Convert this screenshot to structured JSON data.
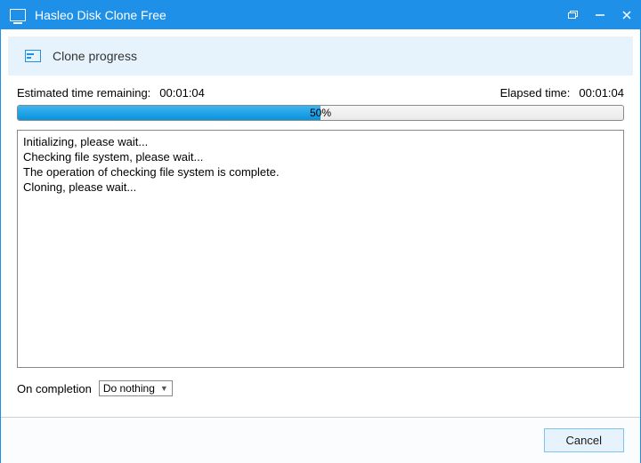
{
  "window": {
    "title": "Hasleo Disk Clone Free"
  },
  "header": {
    "subtitle": "Clone progress"
  },
  "times": {
    "remaining_label": "Estimated time remaining:",
    "remaining_value": "00:01:04",
    "elapsed_label": "Elapsed time:",
    "elapsed_value": "00:01:04"
  },
  "progress": {
    "percent": 50,
    "text": "50%"
  },
  "log": [
    "Initializing, please wait...",
    "Checking file system, please wait...",
    "The operation of checking file system is complete.",
    "Cloning, please wait..."
  ],
  "completion": {
    "label": "On completion",
    "selected": "Do nothing"
  },
  "buttons": {
    "cancel": "Cancel"
  }
}
